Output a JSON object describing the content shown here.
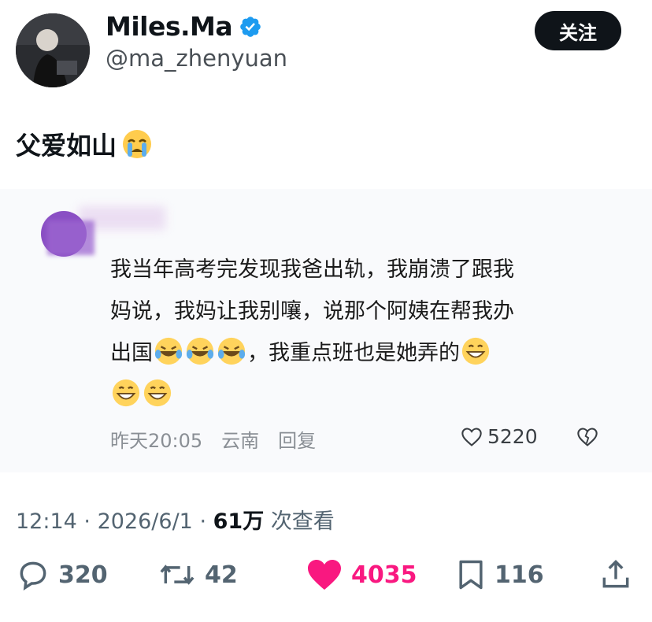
{
  "author": {
    "name": "Miles.Ma",
    "handle": "@ma_zhenyuan",
    "follow_label": "关注"
  },
  "tweet": {
    "text": "父爱如山"
  },
  "quoted_comment": {
    "body_line1": "我当年高考完发现我爸出轨，我崩溃了跟我",
    "body_line2": "妈说，我妈让我别嚷，说那个阿姨在帮我办",
    "body_line3a": "出国",
    "body_line3b": "，我重点班也是她弄的",
    "time": "昨天20:05",
    "location": "云南",
    "reply_label": "回复",
    "likes": "5220"
  },
  "meta": {
    "time": "12:14",
    "date": "2026/6/1",
    "views": "61万",
    "views_label": "次查看"
  },
  "actions": {
    "replies": "320",
    "retweets": "42",
    "likes": "4035",
    "bookmarks": "116"
  },
  "colors": {
    "like": "#f91880",
    "verified": "#1d9bf0",
    "text": "#0f1419",
    "secondary": "#536471"
  }
}
